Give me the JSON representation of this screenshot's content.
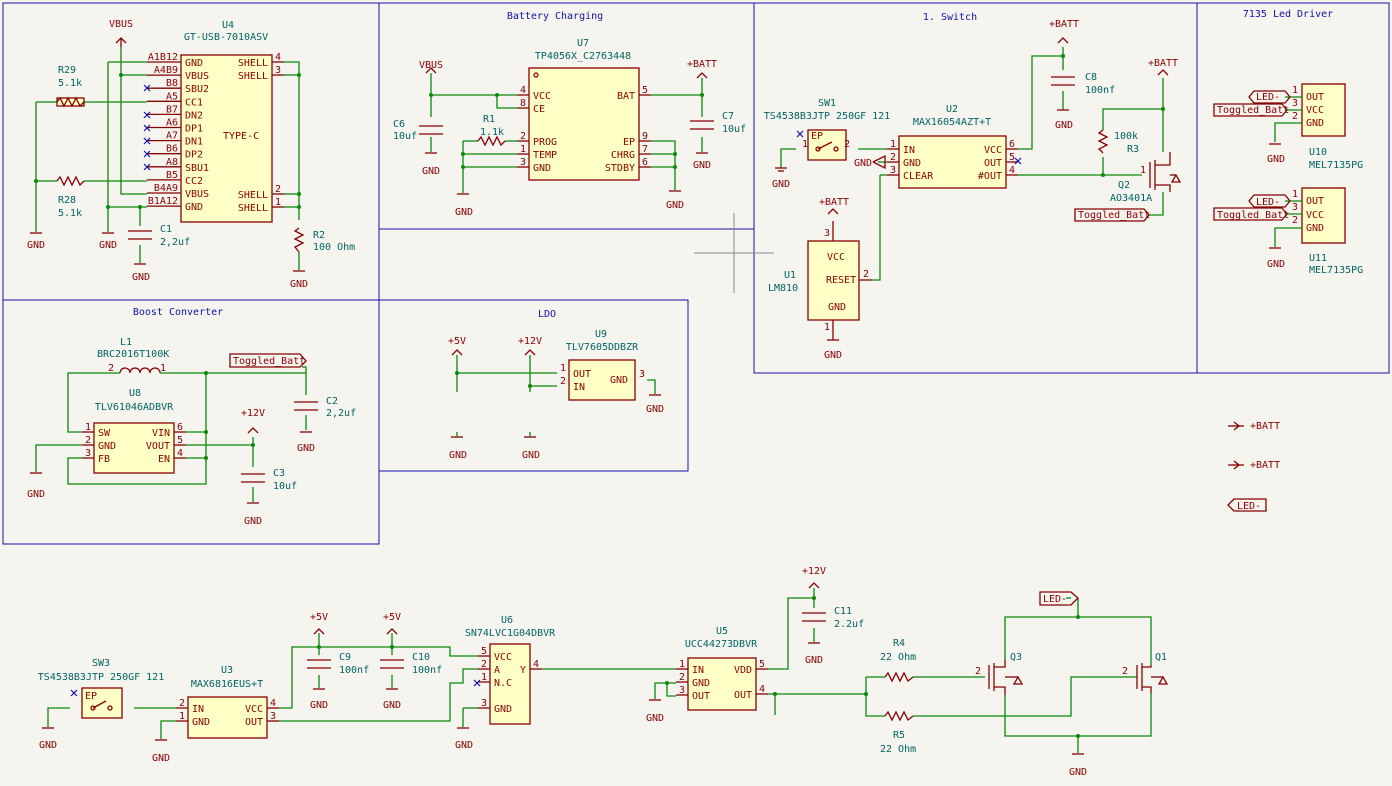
{
  "sections": {
    "battery": "Battery Charging",
    "switch": "1. Switch",
    "led_driver": "7135 Led Driver",
    "boost": "Boost Converter",
    "ldo": "LDO"
  },
  "nets": {
    "vbus": "VBUS",
    "batt": "+BATT",
    "gnd": "GND",
    "v5": "+5V",
    "v12": "+12V",
    "toggled": "Toggled_Batt",
    "led": "LED-"
  },
  "parts": {
    "u4": {
      "ref": "U4",
      "value": "GT-USB-7010ASV",
      "body": "TYPE-C",
      "left_pins": [
        {
          "num": "A1B12",
          "name": "GND"
        },
        {
          "num": "A4B9",
          "name": "VBUS"
        },
        {
          "num": "B8",
          "name": "SBU2"
        },
        {
          "num": "A5",
          "name": "CC1"
        },
        {
          "num": "B7",
          "name": "DN2"
        },
        {
          "num": "A6",
          "name": "DP1"
        },
        {
          "num": "A7",
          "name": "DN1"
        },
        {
          "num": "B6",
          "name": "DP2"
        },
        {
          "num": "A8",
          "name": "SBU1"
        },
        {
          "num": "B5",
          "name": "CC2"
        },
        {
          "num": "B4A9",
          "name": "VBUS"
        },
        {
          "num": "B1A12",
          "name": "GND"
        }
      ],
      "right_pins": [
        {
          "num": "4",
          "name": "SHELL"
        },
        {
          "num": "3",
          "name": "SHELL"
        },
        {
          "num": "2",
          "name": "SHELL"
        },
        {
          "num": "1",
          "name": "SHELL"
        }
      ]
    },
    "r29": {
      "ref": "R29",
      "value": "5.1k"
    },
    "r28": {
      "ref": "R28",
      "value": "5.1k"
    },
    "c1": {
      "ref": "C1",
      "value": "2,2uf"
    },
    "r2": {
      "ref": "R2",
      "value": "100 Ohm"
    },
    "u7": {
      "ref": "U7",
      "value": "TP4056X_C2763448",
      "left_pins": [
        {
          "num": "4",
          "name": "VCC"
        },
        {
          "num": "8",
          "name": "CE"
        },
        {
          "num": "2",
          "name": "PROG"
        },
        {
          "num": "1",
          "name": "TEMP"
        },
        {
          "num": "3",
          "name": "GND"
        }
      ],
      "right_pins": [
        {
          "num": "5",
          "name": "BAT"
        },
        {
          "num": "9",
          "name": "EP"
        },
        {
          "num": "7",
          "name": "CHRG"
        },
        {
          "num": "6",
          "name": "STDBY"
        }
      ]
    },
    "c6": {
      "ref": "C6",
      "value": "10uf"
    },
    "r1": {
      "ref": "R1",
      "value": "1.1k"
    },
    "c7": {
      "ref": "C7",
      "value": "10uf"
    },
    "sw1": {
      "ref": "SW1",
      "value": "TS4538B3JTP 250GF 121",
      "pin_ep": "EP"
    },
    "u2": {
      "ref": "U2",
      "value": "MAX16054AZT+T",
      "left_pins": [
        {
          "num": "1",
          "name": "IN"
        },
        {
          "num": "2",
          "name": "GND"
        },
        {
          "num": "3",
          "name": "CLEAR"
        }
      ],
      "right_pins": [
        {
          "num": "6",
          "name": "VCC"
        },
        {
          "num": "5",
          "name": "OUT"
        },
        {
          "num": "4",
          "name": "#OUT"
        }
      ]
    },
    "c8": {
      "ref": "C8",
      "value": "100nf"
    },
    "r3": {
      "ref": "R3",
      "value": "100k"
    },
    "q2": {
      "ref": "Q2",
      "value": "AO3401A"
    },
    "u1": {
      "ref": "U1",
      "value": "LM810",
      "pins": [
        {
          "num": "3",
          "name": "VCC"
        },
        {
          "num": "2",
          "name": "RESET"
        },
        {
          "num": "1",
          "name": "GND"
        }
      ]
    },
    "u10": {
      "ref": "U10",
      "value": "MEL7135PG",
      "pins": [
        {
          "num": "1",
          "name": "OUT"
        },
        {
          "num": "3",
          "name": "VCC"
        },
        {
          "num": "2",
          "name": "GND"
        }
      ]
    },
    "u11": {
      "ref": "U11",
      "value": "MEL7135PG",
      "pins": [
        {
          "num": "1",
          "name": "OUT"
        },
        {
          "num": "3",
          "name": "VCC"
        },
        {
          "num": "2",
          "name": "GND"
        }
      ]
    },
    "l1": {
      "ref": "L1",
      "value": "BRC2016T100K"
    },
    "u8": {
      "ref": "U8",
      "value": "TLV61046ADBVR",
      "left_pins": [
        {
          "num": "1",
          "name": "SW"
        },
        {
          "num": "2",
          "name": "GND"
        },
        {
          "num": "3",
          "name": "FB"
        }
      ],
      "right_pins": [
        {
          "num": "6",
          "name": "VIN"
        },
        {
          "num": "5",
          "name": "VOUT"
        },
        {
          "num": "4",
          "name": "EN"
        }
      ]
    },
    "c2": {
      "ref": "C2",
      "value": "2,2uf"
    },
    "c3": {
      "ref": "C3",
      "value": "10uf"
    },
    "u9": {
      "ref": "U9",
      "value": "TLV7605DDBZR",
      "pins": [
        {
          "num": "1",
          "name": "OUT"
        },
        {
          "num": "2",
          "name": "IN"
        },
        {
          "num": "3",
          "name": "GND"
        }
      ]
    },
    "sw3": {
      "ref": "SW3",
      "value": "TS4538B3JTP 250GF 121",
      "pin_ep": "EP"
    },
    "u3": {
      "ref": "U3",
      "value": "MAX6816EUS+T",
      "left_pins": [
        {
          "num": "2",
          "name": "IN"
        },
        {
          "num": "1",
          "name": "GND"
        }
      ],
      "right_pins": [
        {
          "num": "4",
          "name": "VCC"
        },
        {
          "num": "3",
          "name": "OUT"
        }
      ]
    },
    "c9": {
      "ref": "C9",
      "value": "100nf"
    },
    "c10": {
      "ref": "C10",
      "value": "100nf"
    },
    "u6": {
      "ref": "U6",
      "value": "SN74LVC1G04DBVR",
      "left_pins": [
        {
          "num": "5",
          "name": "VCC"
        },
        {
          "num": "2",
          "name": "A"
        },
        {
          "num": "1",
          "name": "N.C"
        },
        {
          "num": "3",
          "name": "GND"
        }
      ],
      "right_pins": [
        {
          "num": "4",
          "name": "Y"
        }
      ]
    },
    "u5": {
      "ref": "U5",
      "value": "UCC44273DBVR",
      "left_pins": [
        {
          "num": "1",
          "name": "IN"
        },
        {
          "num": "2",
          "name": "GND"
        },
        {
          "num": "3",
          "name": "OUT"
        }
      ],
      "right_pins": [
        {
          "num": "5",
          "name": "VDD"
        },
        {
          "num": "4",
          "name": "OUT"
        }
      ]
    },
    "c11": {
      "ref": "C11",
      "value": "2.2uf"
    },
    "r4": {
      "ref": "R4",
      "value": "22 Ohm"
    },
    "r5": {
      "ref": "R5",
      "value": "22 Ohm"
    },
    "q3": {
      "ref": "Q3"
    },
    "q1": {
      "ref": "Q1"
    }
  }
}
